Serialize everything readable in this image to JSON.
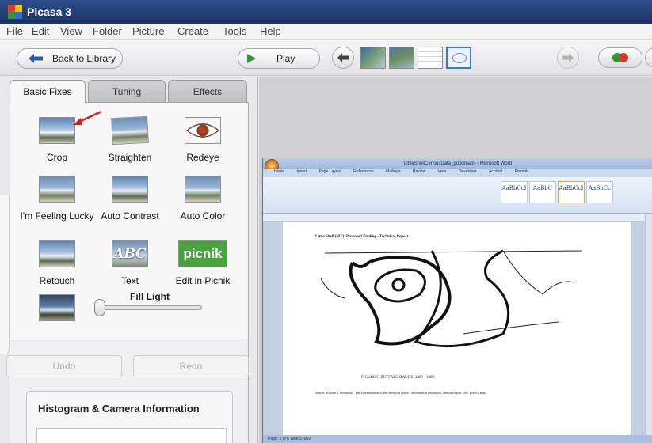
{
  "window": {
    "title": "Picasa 3"
  },
  "menu": [
    "File",
    "Edit",
    "View",
    "Folder",
    "Picture",
    "Create",
    "Tools",
    "Help"
  ],
  "toolbar": {
    "back_label": "Back to Library",
    "play_label": "Play"
  },
  "tabs": [
    {
      "label": "Basic Fixes",
      "active": true
    },
    {
      "label": "Tuning",
      "active": false
    },
    {
      "label": "Effects",
      "active": false
    }
  ],
  "tools": [
    {
      "label": "Crop",
      "icon": "crop-icon"
    },
    {
      "label": "Straighten",
      "icon": "straighten-icon"
    },
    {
      "label": "Redeye",
      "icon": "redeye-icon"
    },
    {
      "label": "I'm Feeling Lucky",
      "icon": "feeling-lucky-icon"
    },
    {
      "label": "Auto Contrast",
      "icon": "auto-contrast-icon"
    },
    {
      "label": "Auto Color",
      "icon": "auto-color-icon"
    },
    {
      "label": "Retouch",
      "icon": "retouch-icon"
    },
    {
      "label": "Text",
      "icon": "text-icon",
      "glyph": "ABC"
    },
    {
      "label": "Edit in Picnik",
      "icon": "picnik-icon",
      "glyph": "picnik"
    }
  ],
  "fill_light": {
    "label": "Fill Light",
    "value": 0.0
  },
  "actions": {
    "undo_label": "Undo",
    "redo_label": "Redo"
  },
  "histogram": {
    "title": "Histogram & Camera Information"
  },
  "embedded_word": {
    "title": "LittleShellCensusData_goodmaps - Microsoft Word",
    "tabs": [
      "Home",
      "Insert",
      "Page Layout",
      "References",
      "Mailings",
      "Review",
      "View",
      "Developer",
      "Acrobat",
      "Format"
    ],
    "styles": [
      "AaBbCcI",
      "AaBbC",
      "AaBbCcI",
      "AaBbCc"
    ],
    "doc_heading": "Little Shell (MT): Proposed Finding - Technical Report",
    "figure_caption": "FIGURE 5: BUFFALO RANGE, 1800 - 1889",
    "source_note": "Source: William T. Hornaday, \"The Extermination of the American Bison,\" Smithsonian Institution, Annual Report, 1887 (1889), map",
    "status": "Page: 5 of 6   Words: 869"
  },
  "colors": {
    "titlebar": "#233f78",
    "accent": "#3a78d8",
    "picnik_green": "#47a33c",
    "arrow_red": "#d21f1f"
  }
}
